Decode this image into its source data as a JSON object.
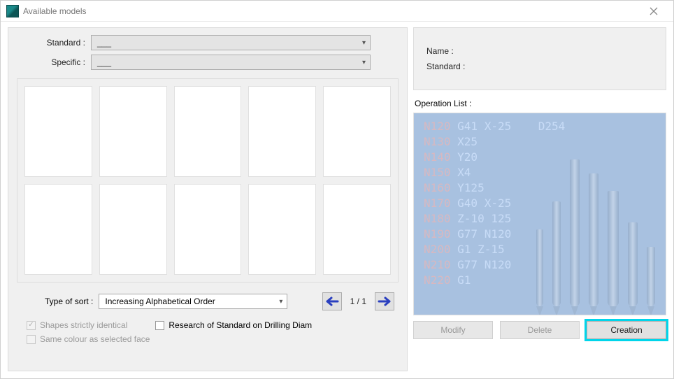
{
  "window": {
    "title": "Available models"
  },
  "filters": {
    "standard_label": "Standard :",
    "standard_value": "___",
    "specific_label": "Specific :",
    "specific_value": "___"
  },
  "sort": {
    "label": "Type of sort :",
    "value": "Increasing Alphabetical Order"
  },
  "pagination": {
    "readout": "1 / 1"
  },
  "checkboxes": {
    "shapes_identical": {
      "label": "Shapes strictly identical",
      "checked": true,
      "enabled": false
    },
    "research_drilling": {
      "label": "Research of Standard on Drilling Diam",
      "checked": false,
      "enabled": true
    },
    "same_colour": {
      "label": "Same colour as selected face",
      "checked": false,
      "enabled": false
    }
  },
  "right": {
    "name_label": "Name :",
    "name_value": "",
    "standard_label": "Standard :",
    "standard_value": "",
    "operation_list_label": "Operation List :"
  },
  "gcode_lines": [
    "N120 G41 X-25    D254",
    "N130 X25",
    "N140 Y20",
    "N150 X4",
    "N160 Y125",
    "N170 G40 X-25",
    "N180 Z-10 125",
    "N190 G77 N120",
    "N200 G1 Z-15",
    "N210 G77 N120",
    "N220 G1"
  ],
  "buttons": {
    "modify": "Modify",
    "delete": "Delete",
    "creation": "Creation"
  }
}
